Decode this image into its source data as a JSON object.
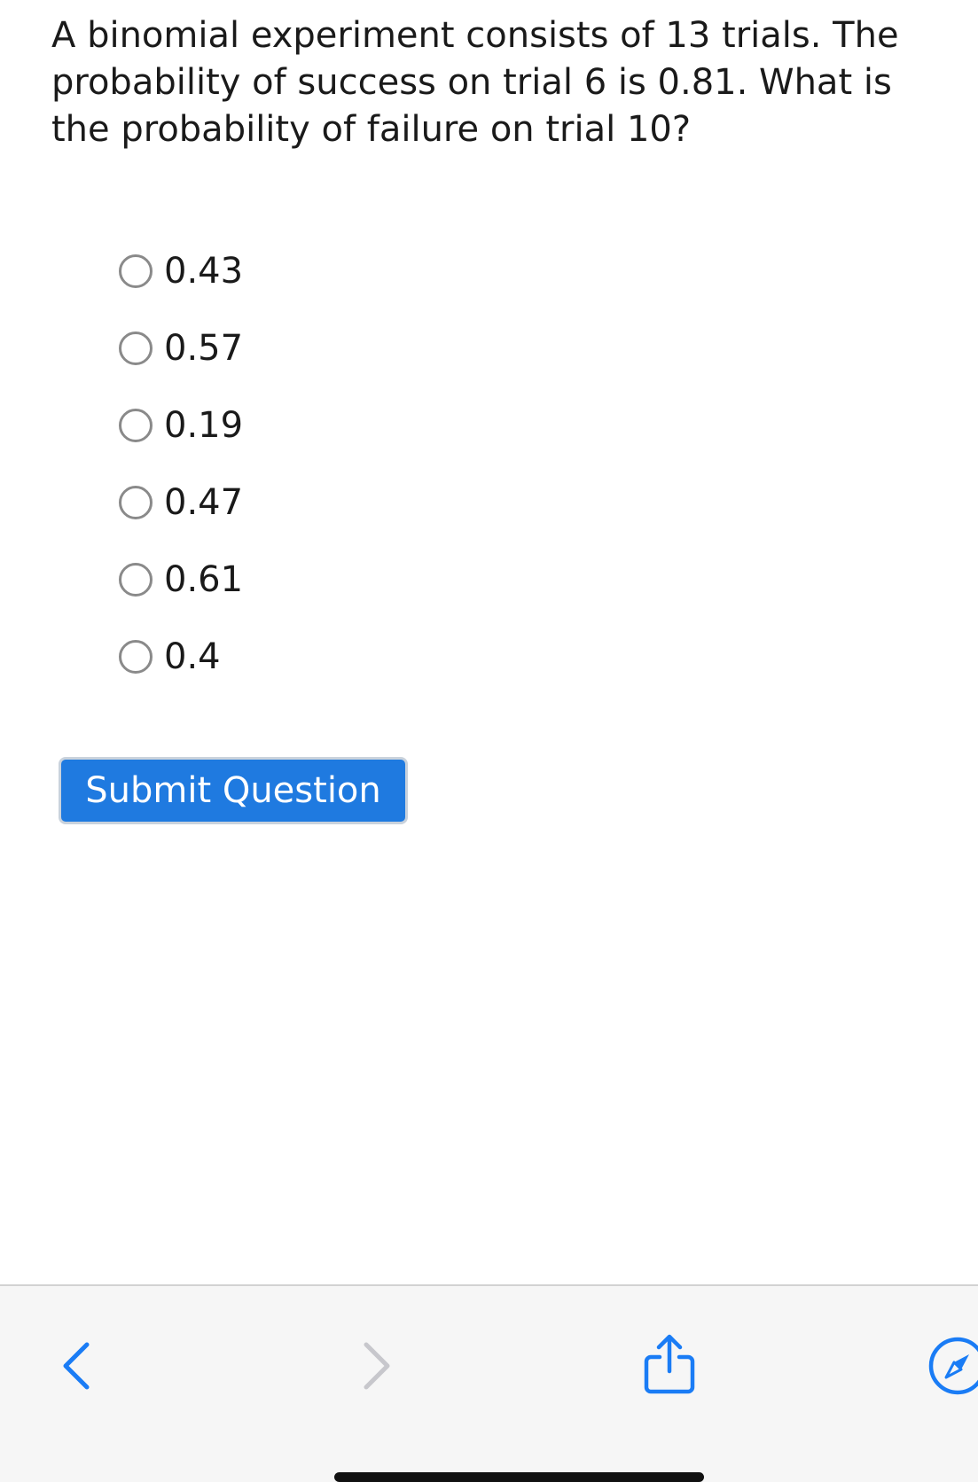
{
  "question": {
    "text": "A binomial experiment consists of 13 trials. The probability of success on trial 6 is 0.81. What is the probability of failure on trial 10?"
  },
  "options": [
    {
      "label": "0.43",
      "selected": false
    },
    {
      "label": "0.57",
      "selected": false
    },
    {
      "label": "0.19",
      "selected": false
    },
    {
      "label": "0.47",
      "selected": false
    },
    {
      "label": "0.61",
      "selected": false
    },
    {
      "label": "0.4",
      "selected": false
    }
  ],
  "submit": {
    "label": "Submit Question",
    "color": "#1f7ae0"
  },
  "toolbar": {
    "icons": [
      "chevron-left-icon",
      "chevron-right-icon",
      "share-icon",
      "compass-icon"
    ],
    "accent_color": "#1a7cf5",
    "disabled_color": "#c7c7cc"
  }
}
